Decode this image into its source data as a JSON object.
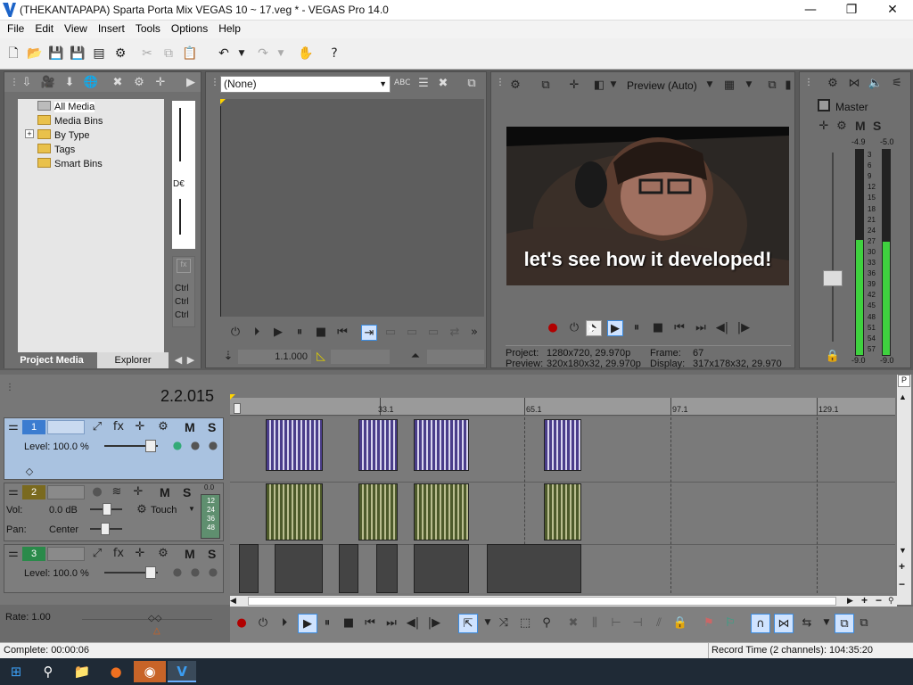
{
  "window": {
    "title": "(THEKANTAPAPA) Sparta Porta Mix VEGAS 10 ~ 17.veg * - VEGAS Pro 14.0",
    "minimize": "—",
    "maximize": "❐",
    "close": "✕"
  },
  "menu": [
    "File",
    "Edit",
    "View",
    "Insert",
    "Tools",
    "Options",
    "Help"
  ],
  "project_media": {
    "tree": [
      "All Media",
      "Media Bins",
      "By Type",
      "Tags",
      "Smart Bins"
    ],
    "expand_glyph": "+",
    "tabs": [
      "Project Media",
      "Explorer"
    ],
    "side_label": "D€",
    "shortcut_labels": [
      "Ctrl",
      "Ctrl",
      "Ctrl"
    ]
  },
  "trimmer": {
    "selector_value": "(None)",
    "timecode": "1.1.000"
  },
  "preview": {
    "mode": "Preview (Auto)",
    "caption": "let's see how it developed!",
    "info": {
      "project_label": "Project:",
      "project_value": "1280x720, 29.970p",
      "preview_label": "Preview:",
      "preview_value": "320x180x32, 29.970p",
      "frame_label": "Frame:",
      "frame_value": "67",
      "display_label": "Display:",
      "display_value": "317x178x32, 29.970"
    }
  },
  "master": {
    "title": "Master",
    "m": "M",
    "s": "S",
    "peak_left": "-4.9",
    "peak_right": "-5.0",
    "scale": [
      "3",
      "6",
      "9",
      "12",
      "15",
      "18",
      "21",
      "24",
      "27",
      "30",
      "33",
      "36",
      "39",
      "42",
      "45",
      "48",
      "51",
      "54",
      "57"
    ],
    "bottom_left": "-9.0",
    "bottom_right": "-9.0",
    "meter_levels": [
      0.56,
      0.55
    ]
  },
  "timeline": {
    "position": "2.2.015",
    "ruler": [
      "33.1",
      "65.1",
      "97.1",
      "129.1"
    ],
    "rate_label": "Rate: 1.00",
    "tracks": [
      {
        "number": "1",
        "level": "Level: 100.0 %",
        "m": "M",
        "s": "S"
      },
      {
        "number": "2",
        "vol_label": "Vol:",
        "vol": "0.0 dB",
        "pan_label": "Pan:",
        "pan": "Center",
        "automation": "Touch",
        "m": "M",
        "s": "S",
        "meter_top": "0.0",
        "meter_scale": [
          "12",
          "24",
          "36",
          "48"
        ]
      },
      {
        "number": "3",
        "level": "Level: 100.0 %",
        "m": "M",
        "s": "S"
      }
    ]
  },
  "status": {
    "left": "Complete: 00:00:06",
    "right": "Record Time (2 channels): 104:35:20"
  },
  "colors": {
    "accent": "#3b8be0",
    "video_track": "#a9c2e0",
    "meter_green": "#3fd13f"
  }
}
